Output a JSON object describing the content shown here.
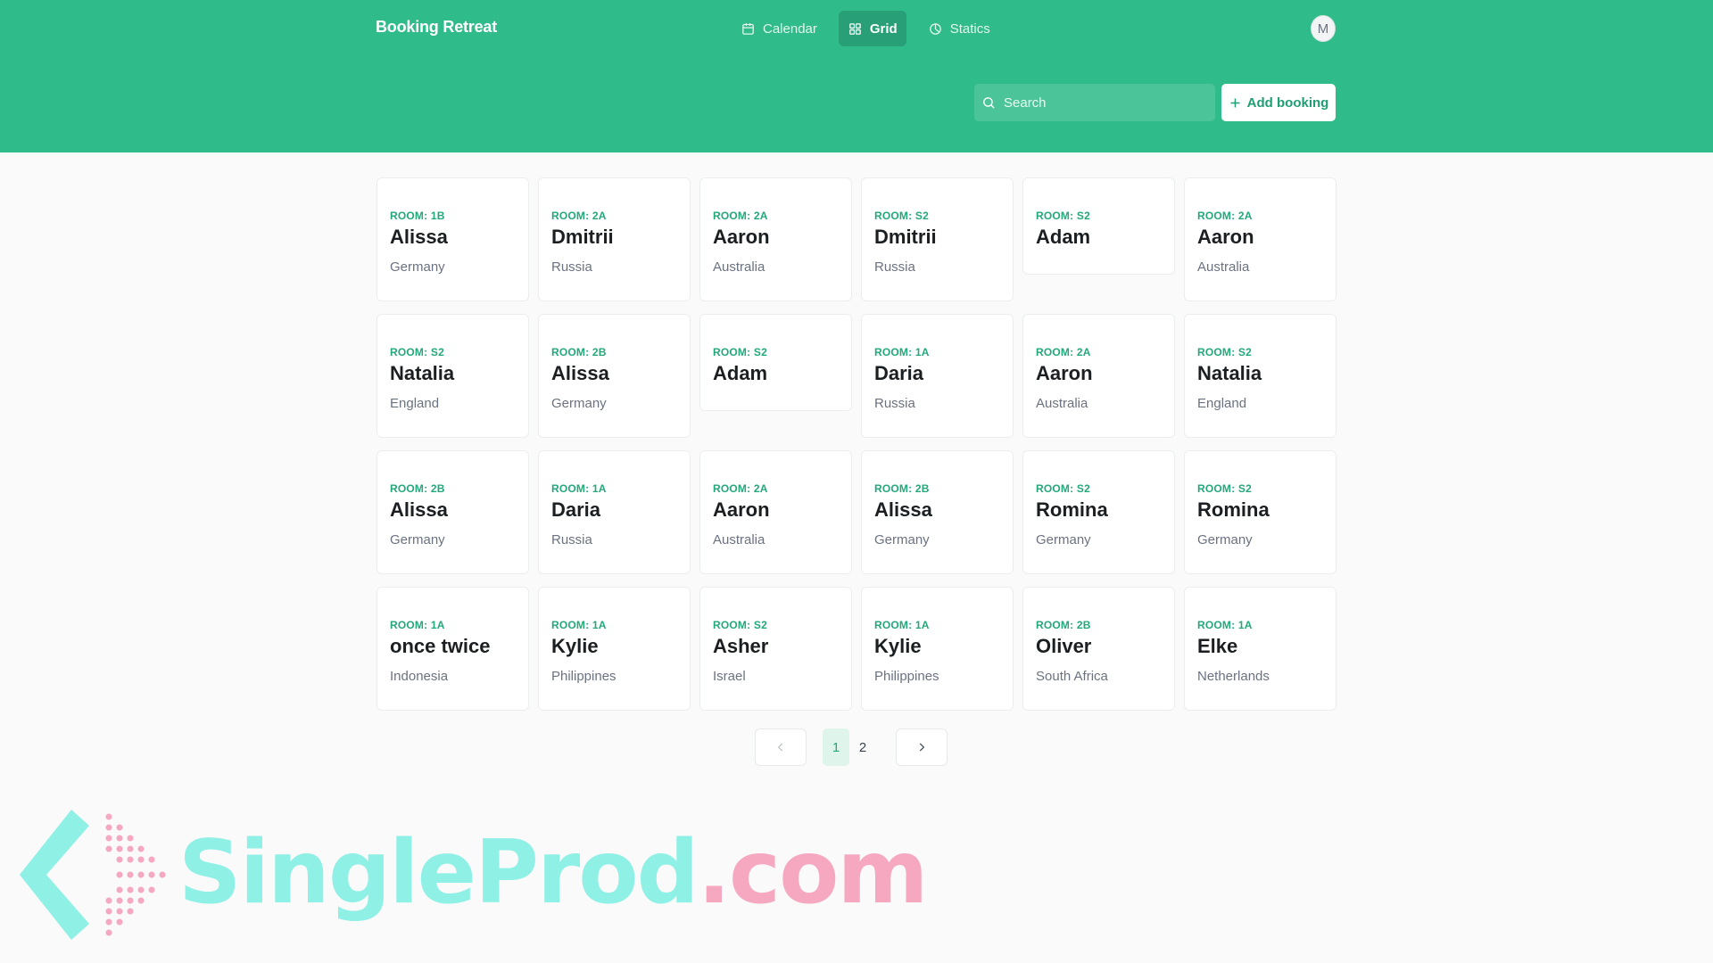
{
  "app": {
    "title": "Booking Retreat",
    "avatar_initial": "M"
  },
  "nav": [
    {
      "label": "Calendar",
      "icon": "calendar-icon",
      "active": false
    },
    {
      "label": "Grid",
      "icon": "grid-icon",
      "active": true
    },
    {
      "label": "Statics",
      "icon": "pie-chart-icon",
      "active": false
    }
  ],
  "search": {
    "placeholder": "Search",
    "value": ""
  },
  "add_button": {
    "label": "Add booking"
  },
  "bookings": [
    {
      "room": "ROOM: 1B",
      "name": "Alissa",
      "country": "Germany"
    },
    {
      "room": "ROOM: 2A",
      "name": "Dmitrii",
      "country": "Russia"
    },
    {
      "room": "ROOM: 2A",
      "name": "Aaron",
      "country": "Australia"
    },
    {
      "room": "ROOM: S2",
      "name": "Dmitrii",
      "country": "Russia"
    },
    {
      "room": "ROOM: S2",
      "name": "Adam",
      "country": ""
    },
    {
      "room": "ROOM: 2A",
      "name": "Aaron",
      "country": "Australia"
    },
    {
      "room": "ROOM: S2",
      "name": "Natalia",
      "country": "England"
    },
    {
      "room": "ROOM: 2B",
      "name": "Alissa",
      "country": "Germany"
    },
    {
      "room": "ROOM: S2",
      "name": "Adam",
      "country": ""
    },
    {
      "room": "ROOM: 1A",
      "name": "Daria",
      "country": "Russia"
    },
    {
      "room": "ROOM: 2A",
      "name": "Aaron",
      "country": "Australia"
    },
    {
      "room": "ROOM: S2",
      "name": "Natalia",
      "country": "England"
    },
    {
      "room": "ROOM: 2B",
      "name": "Alissa",
      "country": "Germany"
    },
    {
      "room": "ROOM: 1A",
      "name": "Daria",
      "country": "Russia"
    },
    {
      "room": "ROOM: 2A",
      "name": "Aaron",
      "country": "Australia"
    },
    {
      "room": "ROOM: 2B",
      "name": "Alissa",
      "country": "Germany"
    },
    {
      "room": "ROOM: S2",
      "name": "Romina",
      "country": "Germany"
    },
    {
      "room": "ROOM: S2",
      "name": "Romina",
      "country": "Germany"
    },
    {
      "room": "ROOM: 1A",
      "name": "once twice",
      "country": "Indonesia"
    },
    {
      "room": "ROOM: 1A",
      "name": "Kylie",
      "country": "Philippines"
    },
    {
      "room": "ROOM: S2",
      "name": "Asher",
      "country": "Israel"
    },
    {
      "room": "ROOM: 1A",
      "name": "Kylie",
      "country": "Philippines"
    },
    {
      "room": "ROOM: 2B",
      "name": "Oliver",
      "country": "South Africa"
    },
    {
      "room": "ROOM: 1A",
      "name": "Elke",
      "country": "Netherlands"
    }
  ],
  "pagination": {
    "pages": [
      "1",
      "2"
    ],
    "current": "1"
  },
  "watermark": {
    "text_a": "SingleProd",
    "text_b": ".com"
  },
  "colors": {
    "accent": "#2fbb8a",
    "room_label": "#23a87a"
  }
}
